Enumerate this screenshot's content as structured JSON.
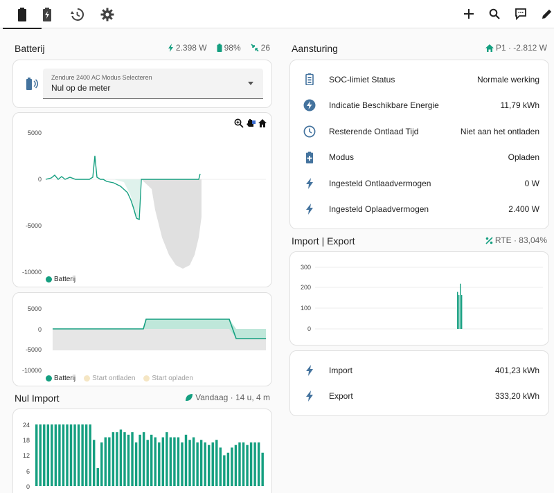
{
  "toolbar": {
    "tabs": [
      {
        "icon": "battery-icon",
        "active": true
      },
      {
        "icon": "battery-bolt-icon",
        "active": false
      },
      {
        "icon": "history-icon",
        "active": false
      },
      {
        "icon": "gear-icon",
        "active": false
      }
    ],
    "actions": [
      "plus-icon",
      "search-icon",
      "chat-icon",
      "pencil-icon"
    ]
  },
  "batterij": {
    "title": "Batterij",
    "power": "2.398 W",
    "soc": "98%",
    "count": "26",
    "select_label": "Zendure 2400 AC Modus Selecteren",
    "select_value": "Nul op de meter",
    "chart1": {
      "yticks": [
        "5000",
        "0",
        "-5000",
        "-10000"
      ],
      "legend": [
        "Batterij"
      ]
    },
    "chart2": {
      "yticks": [
        "5000",
        "0",
        "-5000",
        "-10000"
      ],
      "legend": [
        "Batterij",
        "Start ontladen",
        "Start opladen"
      ]
    }
  },
  "nul_import": {
    "title": "Nul Import",
    "meta": "Vandaag · 14 u, 4 m",
    "chart_data": {
      "type": "bar",
      "yticks": [
        "24",
        "18",
        "12",
        "6",
        "0"
      ],
      "ylim": [
        0,
        24
      ],
      "values": [
        24,
        24,
        24,
        24,
        24,
        24,
        24,
        24,
        24,
        24,
        24,
        24,
        24,
        24,
        24,
        18,
        7,
        17,
        19,
        19,
        21,
        21,
        22,
        21,
        20,
        21,
        17,
        20,
        21,
        18,
        20,
        19,
        17,
        19,
        21,
        19,
        19,
        19,
        17,
        20,
        18,
        19,
        17,
        18,
        17,
        16,
        17,
        18,
        15,
        12,
        13,
        15,
        16,
        17,
        17,
        16,
        17,
        17,
        17,
        13
      ]
    }
  },
  "aansturing": {
    "title": "Aansturing",
    "meta": "P1 · -2.812 W",
    "rows": [
      {
        "icon": "battery-status-icon",
        "name": "SOC-limiet Status",
        "value": "Normale werking"
      },
      {
        "icon": "flash-circle-icon",
        "name": "Indicatie Beschikbare Energie",
        "value": "11,79 kWh"
      },
      {
        "icon": "clock-icon",
        "name": "Resterende Ontlaad Tijd",
        "value": "Niet aan het ontladen"
      },
      {
        "icon": "battery-plus-icon",
        "name": "Modus",
        "value": "Opladen"
      },
      {
        "icon": "flash-icon",
        "name": "Ingesteld Ontlaadvermogen",
        "value": "0 W"
      },
      {
        "icon": "flash-icon",
        "name": "Ingesteld Oplaadvermogen",
        "value": "2.400 W"
      }
    ]
  },
  "import_export": {
    "title": "Import | Export",
    "meta": "RTE · 83,04%",
    "chart_data": {
      "type": "bar",
      "yticks": [
        "300",
        "200",
        "100",
        "0"
      ],
      "ylim": [
        0,
        300
      ],
      "values": [
        180,
        165,
        220,
        165
      ]
    },
    "rows": [
      {
        "icon": "flash-icon",
        "name": "Import",
        "value": "401,23 kWh"
      },
      {
        "icon": "flash-icon",
        "name": "Export",
        "value": "333,20 kWh"
      }
    ]
  },
  "colors": {
    "teal": "#159f80",
    "grey_area": "#e0e0e0",
    "legend_muted": "#f5e6c4"
  }
}
